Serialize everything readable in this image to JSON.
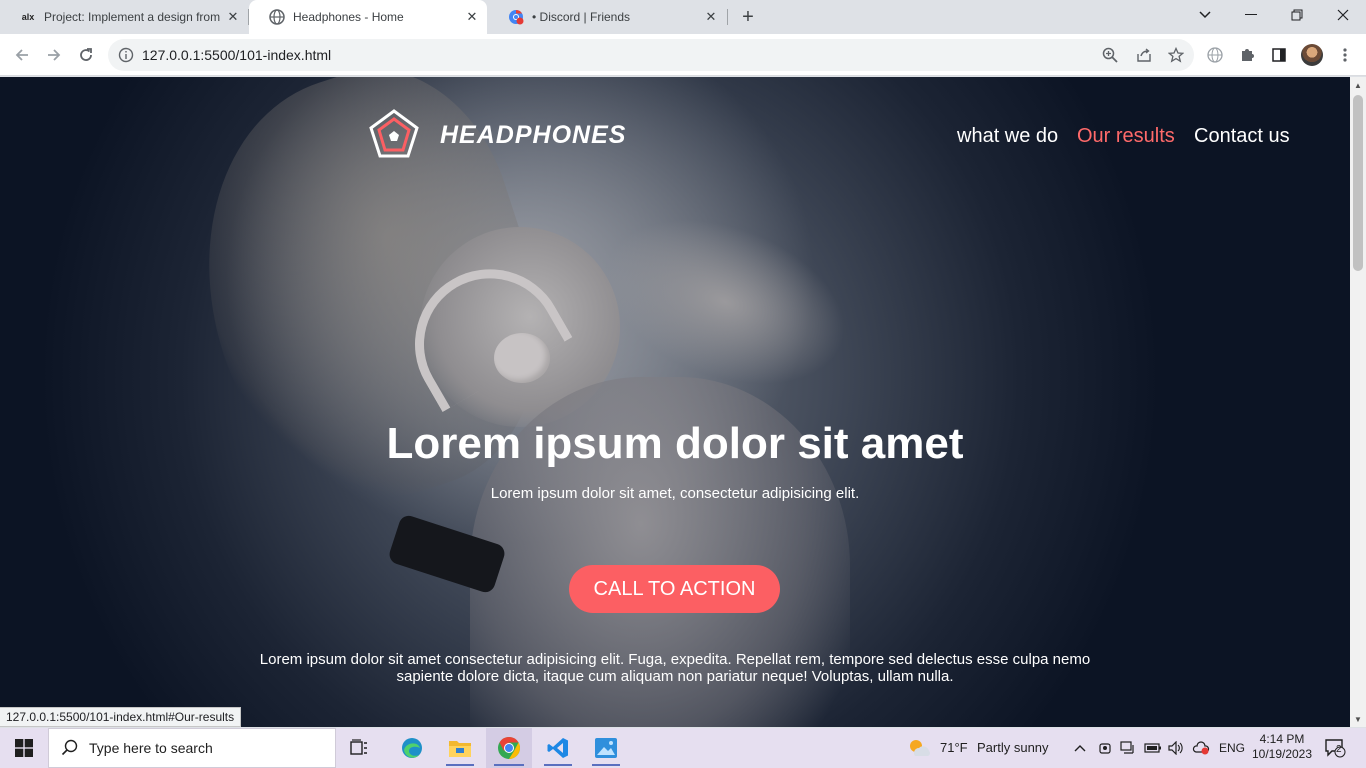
{
  "browser": {
    "tabs": [
      {
        "title": "Project: Implement a design from",
        "favicon": "alx-icon",
        "active": false
      },
      {
        "title": "Headphones - Home",
        "favicon": "globe-icon",
        "active": true
      },
      {
        "title": "• Discord | Friends",
        "favicon": "chrome-discord-icon",
        "active": false
      }
    ],
    "new_tab": "+",
    "url": "127.0.0.1:5500/101-index.html",
    "status_url": "127.0.0.1:5500/101-index.html#Our-results"
  },
  "site": {
    "brand": "HEADPHONES",
    "nav": [
      {
        "label": "what we do",
        "active": false
      },
      {
        "label": "Our results",
        "active": true
      },
      {
        "label": "Contact us",
        "active": false
      }
    ],
    "hero": {
      "title": "Lorem ipsum dolor sit amet",
      "subtitle": "Lorem ipsum dolor sit amet, consectetur adipisicing elit.",
      "cta": "CALL TO ACTION",
      "paragraph": "Lorem ipsum dolor sit amet consectetur adipisicing elit. Fuga, expedita. Repellat rem, tempore sed delectus esse culpa nemo sapiente dolore dicta, itaque cum aliquam non pariatur neque! Voluptas, ullam nulla."
    },
    "accent_color": "#fc5f63"
  },
  "taskbar": {
    "search_placeholder": "Type here to search",
    "weather_temp": "71°F",
    "weather_desc": "Partly sunny",
    "language": "ENG",
    "time": "4:14 PM",
    "date": "10/19/2023",
    "notification_count": "2"
  }
}
